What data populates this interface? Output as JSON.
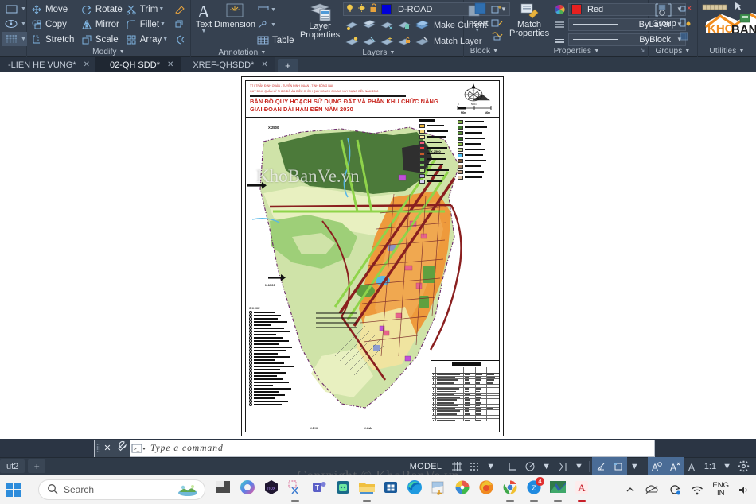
{
  "ribbon": {
    "panels": [
      {
        "name": "draw-panel",
        "title": "",
        "items": [
          "rectangle-icon",
          "ellipse-icon",
          "hatch-icon"
        ]
      },
      {
        "name": "modify-panel",
        "title": "Modify",
        "buttons": [
          "Move",
          "Rotate",
          "Trim",
          "Copy",
          "Mirror",
          "Fillet",
          "Stretch",
          "Scale",
          "Array"
        ]
      },
      {
        "name": "annotation-panel",
        "title": "Annotation",
        "buttons": [
          "Text",
          "Dimension",
          "Table"
        ]
      },
      {
        "name": "layers-panel",
        "title": "Layers",
        "layer_properties_label_1": "Layer",
        "layer_properties_label_2": "Properties",
        "current_layer": "D-ROAD",
        "layer_color": "#0000d8",
        "buttons": [
          "Make Current",
          "Match Layer"
        ]
      },
      {
        "name": "block-panel",
        "title": "Block",
        "insert_label": "Insert"
      },
      {
        "name": "properties-panel",
        "title": "Properties",
        "match_label_1": "Match",
        "match_label_2": "Properties",
        "color_value": "Red",
        "color_hex": "#e62020",
        "linetype_value": "ByLayer",
        "lineweight_value": "ByBlock"
      },
      {
        "name": "groups-panel",
        "title": "Groups",
        "group_label": "Group"
      },
      {
        "name": "utilities-panel",
        "title": "Utilities",
        "logo_text_1": "KHO",
        "logo_text_2": "BANVE"
      }
    ]
  },
  "file_tabs": {
    "tabs": [
      {
        "label": "-LIEN HE VUNG*",
        "active": false
      },
      {
        "label": "02-QH SDD*",
        "active": true
      },
      {
        "label": "XREF-QHSDD*",
        "active": false
      }
    ],
    "add_label": "+"
  },
  "drawing": {
    "title_block": {
      "line1": "TT I TRẦN ĐỊNH QUÁN - TUYẾN ĐỊNH QUÁN - TỈNH ĐỒNG NAI",
      "line2": "QUY ĐỊNH QUẢN LÝ THEO ĐỒ ÁN ĐIỀU CHỈNH QUY HOẠCH CHUNG XÂY DỰNG ĐẾN NĂM 2030",
      "title1": "BẢN ĐỒ QUY HOẠCH SỬ DỤNG ĐẤT VÀ PHÂN KHU CHỨC NĂNG",
      "title2": "GIAI ĐOẠN DÀI HẠN ĐẾN NĂM 2030",
      "scale_left": "0",
      "scale_mid": "500m",
      "scale_unit_1": "M0m",
      "scale_unit_2": "M0m"
    },
    "notes_title": "GHI CHÚ",
    "legend": {
      "left_colors": [
        "#f0b840",
        "#f6d77a",
        "#fbe9a8",
        "#f05a7a",
        "#ef3a3a",
        "#c85a2a",
        "#4e9a3e",
        "#7bbf5e",
        "#b9e08f",
        "#b2a7e0",
        "#d6cff0"
      ],
      "right_colors": [
        "#7aab3e",
        "#3f7a2a",
        "#5a8f35",
        "#2f6b22",
        "#8fbf4a",
        "#c8d89a",
        "#4fc3f7",
        "#7a5a3a",
        "#a08060",
        "#c0a080",
        "#e0c8a8"
      ]
    },
    "map_labels": [
      "X.2500",
      "X.2500",
      "X.1500",
      "X.000",
      "X.PHI",
      "X.OA"
    ],
    "watermark": "KhoBanVe.vn"
  },
  "command_line": {
    "placeholder": "Type a command",
    "close_label": "✕"
  },
  "status_bar": {
    "layout_tab": "ut2",
    "layout_add": "+",
    "model_label": "MODEL",
    "scale": "1:1",
    "toggles": [
      "grid-icon",
      "snap-icon",
      "ortho-icon",
      "polar-icon",
      "osnap-icon",
      "otrack-icon",
      "lineweight-icon",
      "transparency-icon",
      "selection-cycling-icon",
      "annotation-visibility-icon",
      "autoscale-icon",
      "annotation-scale-icon",
      "settings-icon"
    ]
  },
  "taskbar": {
    "search_placeholder": "Search",
    "apps": [
      "start-icon",
      "search-icon",
      "widgets-icon",
      "copilot-icon",
      "nox-icon",
      "snip-icon",
      "teams-icon",
      "zalo-icon",
      "explorer-icon",
      "store-icon",
      "edge-icon",
      "media-icon",
      "paint-icon",
      "firefox-icon",
      "chrome-icon",
      "zoom-icon",
      "map-icon",
      "autocad-icon"
    ],
    "zoom_badge": "4",
    "language_1": "ENG",
    "language_2": "IN",
    "tray": [
      "show-hidden-icon",
      "onedrive-icon",
      "update-icon",
      "wifi-icon"
    ]
  },
  "overlay": {
    "copyright": "Copyright © KhoBanVe.vn"
  }
}
